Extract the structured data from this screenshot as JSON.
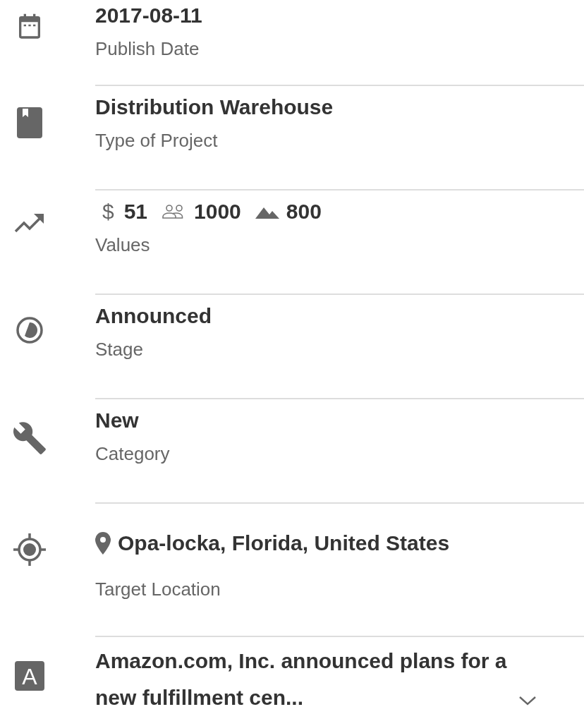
{
  "rows": [
    {
      "kind": "text",
      "title": "2017-08-11",
      "label": "Publish Date"
    },
    {
      "kind": "text",
      "title": "Distribution Warehouse",
      "label": "Type of Project"
    },
    {
      "kind": "values",
      "values": [
        {
          "kind": "money",
          "symbol": "$",
          "value": "51"
        },
        {
          "kind": "people",
          "value": "1000"
        },
        {
          "kind": "area",
          "value": "800"
        }
      ],
      "label": "Values"
    },
    {
      "kind": "text",
      "title": "Announced",
      "label": "Stage"
    },
    {
      "kind": "text",
      "title": "New",
      "label": "Category"
    },
    {
      "kind": "location",
      "title": "Opa-locka, Florida, United States",
      "label": "Target Location"
    },
    {
      "kind": "description",
      "letter": "A",
      "title": "Amazon.com, Inc. announced plans for a new fulfillment cen...",
      "expanded": false
    }
  ]
}
